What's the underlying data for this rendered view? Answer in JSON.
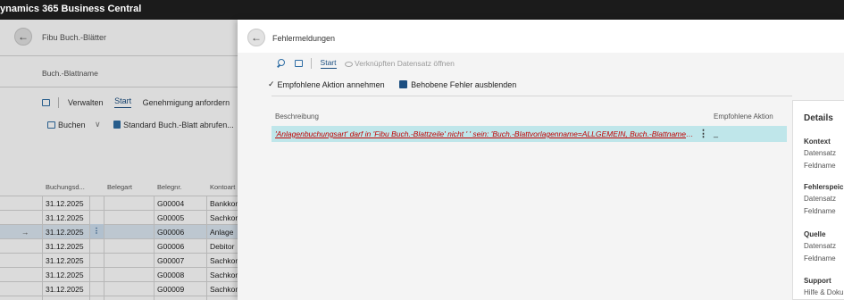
{
  "app": {
    "title": "ynamics 365 Business Central"
  },
  "background_page": {
    "title": "Fibu Buch.-Blätter",
    "field_label": "Buch.-Blattname",
    "tabs": [
      "Verwalten",
      "Start",
      "Genehmigung anfordern"
    ],
    "actions": {
      "post": "Buchen",
      "standard": "Standard Buch.-Blatt abrufen..."
    },
    "columns": [
      "Buchungsd...",
      "Belegart",
      "Belegnr.",
      "Kontoart"
    ],
    "rows": [
      {
        "date": "31.12.2025",
        "doc_no": "G00004",
        "account_type": "Bankkon"
      },
      {
        "date": "31.12.2025",
        "doc_no": "G00005",
        "account_type": "Sachkon"
      },
      {
        "date": "31.12.2025",
        "doc_no": "G00006",
        "account_type": "Anlage"
      },
      {
        "date": "31.12.2025",
        "doc_no": "G00006",
        "account_type": "Debitor"
      },
      {
        "date": "31.12.2025",
        "doc_no": "G00007",
        "account_type": "Sachkon"
      },
      {
        "date": "31.12.2025",
        "doc_no": "G00008",
        "account_type": "Sachkon"
      },
      {
        "date": "31.12.2025",
        "doc_no": "G00009",
        "account_type": "Sachkon"
      }
    ],
    "arrow_glyph": "→",
    "dots_glyph": "⋮"
  },
  "panel": {
    "title": "Fehlermeldungen",
    "toolbar": {
      "start": "Start",
      "open_record": "Verknüpften Datensatz öffnen"
    },
    "actions": {
      "accept": "Empfohlene Aktion annehmen",
      "hide": "Behobene Fehler ausblenden"
    },
    "columns": {
      "description": "Beschreibung",
      "recommended": "Empfohlene Aktion"
    },
    "error_row": {
      "text": "'Anlagenbuchungsart' darf in 'Fibu Buch.-Blattzeile' nicht ' ' sein: 'Buch.-Blattvorlagenname=ALLGEMEIN, Buch.-Blattname=ERÖFFN...",
      "dots": "⋮",
      "action": "_"
    },
    "details": {
      "title": "Details",
      "sections": [
        {
          "heading": "Kontext",
          "fields": [
            "Datensatz",
            "Feldname"
          ]
        },
        {
          "heading": "Fehlerspeicher",
          "fields": [
            "Datensatz",
            "Feldname"
          ]
        },
        {
          "heading": "Quelle",
          "fields": [
            "Datensatz",
            "Feldname"
          ]
        },
        {
          "heading": "Support",
          "fields": [
            "Hilfe & Doku"
          ]
        }
      ]
    }
  },
  "colors": {
    "topbar": "#1b1b1b",
    "accent": "#1b4e80",
    "selected_row": "#bfe6ea",
    "error_text": "#c00000"
  }
}
